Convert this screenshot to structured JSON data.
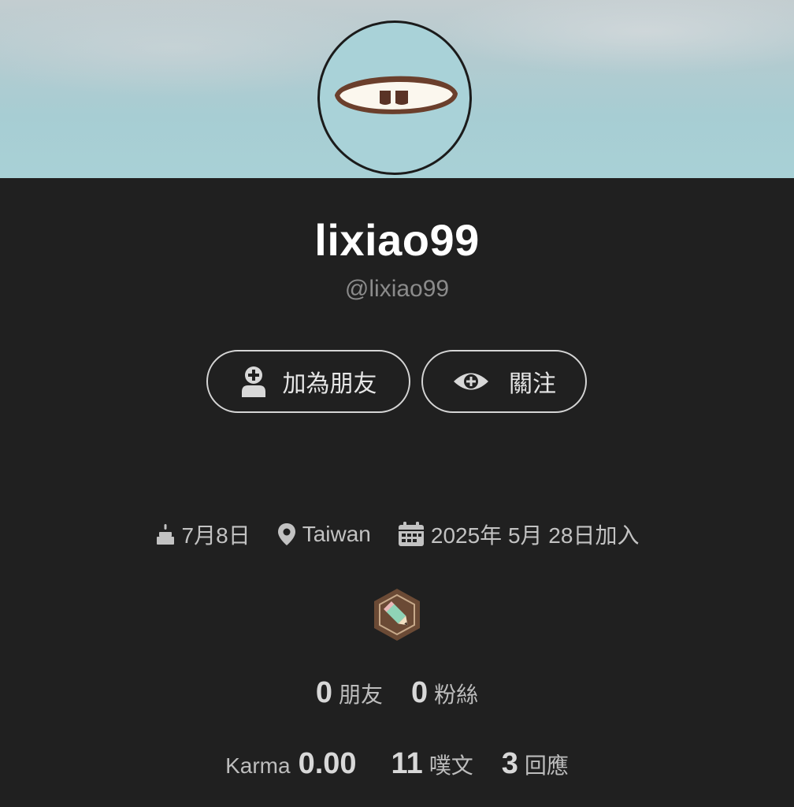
{
  "profile": {
    "display_name": "lixiao99",
    "handle": "@lixiao99"
  },
  "actions": {
    "add_friend_label": "加為朋友",
    "follow_label": "關注"
  },
  "meta": {
    "birthday": "7月8日",
    "location": "Taiwan",
    "joined": "2025年 5月 28日加入"
  },
  "stats": {
    "friends_count": "0",
    "friends_label": "朋友",
    "fans_count": "0",
    "fans_label": "粉絲",
    "karma_label": "Karma",
    "karma_value": "0.00",
    "posts_count": "11",
    "posts_label": "噗文",
    "replies_count": "3",
    "replies_label": "回應"
  },
  "icons": {
    "add_friend": "person-plus-icon",
    "follow": "eye-plus-icon",
    "birthday": "cake-icon",
    "location": "map-pin-icon",
    "joined": "calendar-icon",
    "badge": "pencil-badge-icon"
  },
  "colors": {
    "background": "#202020",
    "banner": "#a8d1d6",
    "text_primary": "#ffffff",
    "text_secondary": "#8b8b8b",
    "button_border": "#d5d5d5",
    "badge_fill": "#6b4a35"
  }
}
